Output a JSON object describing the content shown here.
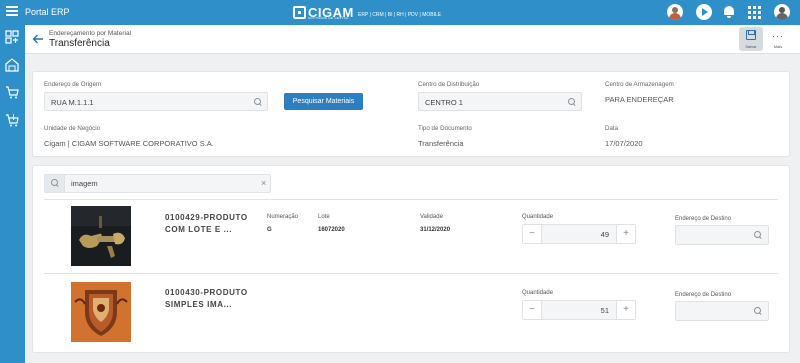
{
  "topbar": {
    "portal_title": "Portal ERP",
    "brand_name": "CIGAM",
    "brand_sub": "SOFTWARE DE GESTÃO",
    "modules": "ERP | CRM | BI | RH | PDV | MOBILE"
  },
  "header": {
    "breadcrumb": "Endereçamento por Material",
    "title": "Transferência",
    "save_label": "Salvar",
    "more_label": "Mais"
  },
  "form": {
    "origin_label": "Endereço de Origem",
    "origin_value": "RUA M.1.1.1",
    "search_button": "Pesquisar Materiais",
    "dc_label": "Centro de Distribuição",
    "dc_value": "CENTRO 1",
    "storage_label": "Centro de Armazenagem",
    "storage_value": "PARA ENDEREÇAR",
    "bu_label": "Unidade de Negócio",
    "bu_value": "Cigam | CIGAM SOFTWARE CORPORATIVO S.A.",
    "doctype_label": "Tipo de Documento",
    "doctype_value": "Transferência",
    "date_label": "Data",
    "date_value": "17/07/2020"
  },
  "list": {
    "search_value": "imagem",
    "labels": {
      "numeracao": "Numeração",
      "lote": "Lote",
      "validade": "Validade",
      "quantidade": "Quantidade",
      "destino": "Endereço de Destino"
    },
    "items": [
      {
        "name_line1": "0100429-PRODUTO",
        "name_line2": "COM LOTE E ...",
        "numeracao": "G",
        "lote": "16072020",
        "validade": "31/12/2020",
        "quantidade": "49"
      },
      {
        "name_line1": "0100430-PRODUTO",
        "name_line2": "SIMPLES IMA...",
        "quantidade": "51"
      }
    ]
  }
}
